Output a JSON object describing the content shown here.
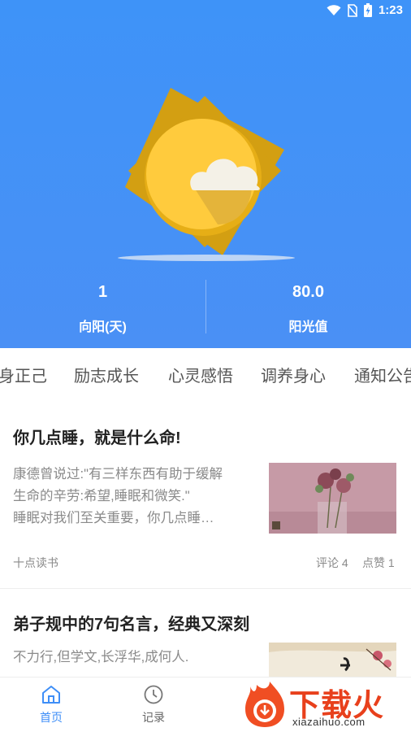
{
  "status_bar": {
    "time": "1:23"
  },
  "stats": [
    {
      "value": "1",
      "label": "向阳(天)"
    },
    {
      "value": "80.0",
      "label": "阳光值"
    }
  ],
  "tabs": [
    "身正己",
    "励志成长",
    "心灵感悟",
    "调养身心",
    "通知公告"
  ],
  "articles": [
    {
      "title": "你几点睡，就是什么命!",
      "lines": [
        "康德曾说过:\"有三样东西有助于缓解",
        "生命的辛劳:希望,睡眠和微笑.\"",
        "睡眠对我们至关重要，你几点睡…"
      ],
      "source": "十点读书",
      "comments": "评论 4",
      "likes": "点赞 1"
    },
    {
      "title": "弟子规中的7句名言，经典又深刻",
      "lines": [
        "不力行,但学文,长浮华,成何人."
      ]
    }
  ],
  "bottom_nav": [
    {
      "label": "首页",
      "icon": "home-icon",
      "active": true
    },
    {
      "label": "记录",
      "icon": "clock-icon",
      "active": false
    }
  ],
  "watermark": {
    "text": "下载火",
    "url": "xiazaihuo.com"
  },
  "colors": {
    "header_blue": "#3E93F8",
    "sun_dark": "#D39F12",
    "sun_face": "#FFCB3D",
    "active": "#3E8EF7"
  }
}
